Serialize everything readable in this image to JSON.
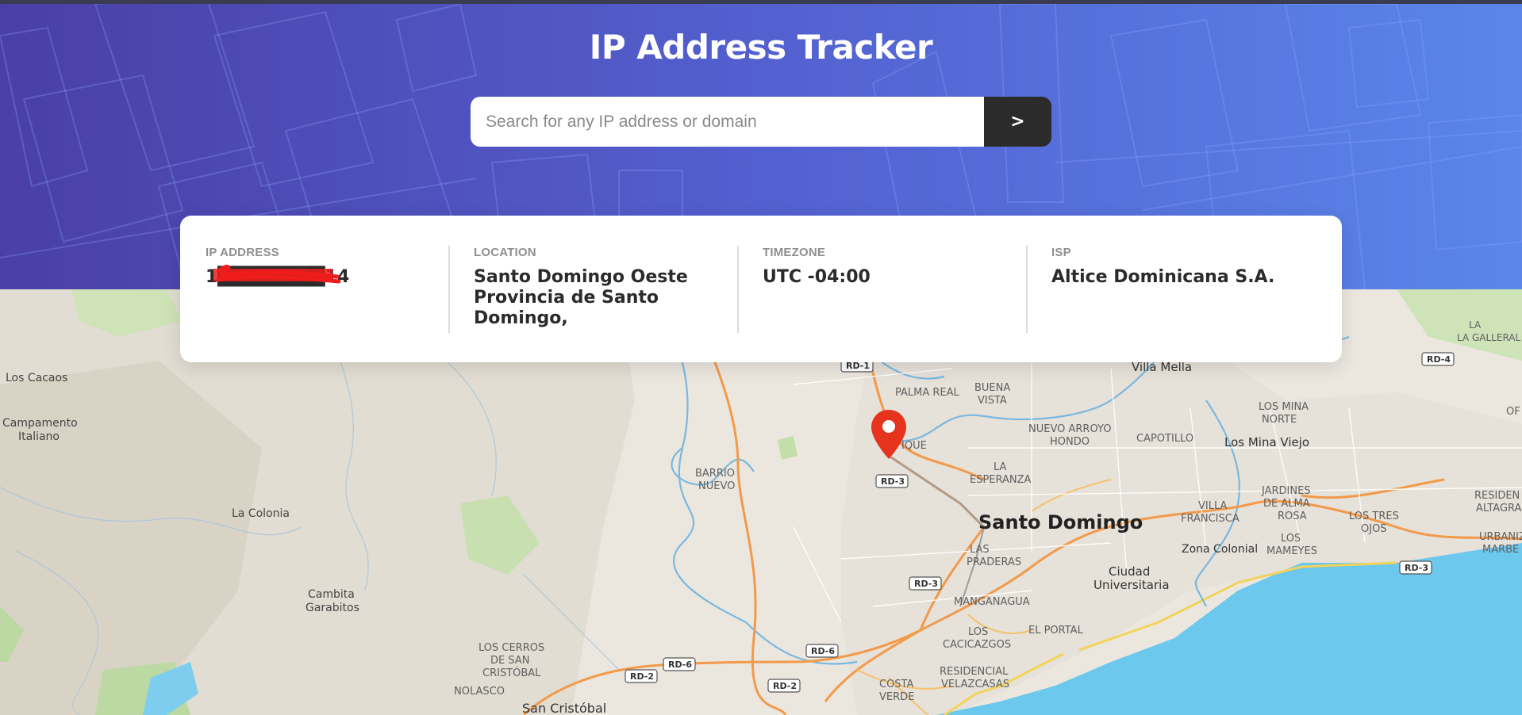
{
  "header": {
    "title": "IP Address Tracker",
    "search": {
      "placeholder": "Search for any IP address or domain",
      "value": "",
      "button_label": ">"
    }
  },
  "info": {
    "ip_label": "IP ADDRESS",
    "ip_value": "1████████14",
    "location_label": "LOCATION",
    "location_value": "Santo Domingo Oeste Provincia de Santo Domingo,",
    "timezone_label": "TIMEZONE",
    "timezone_value": "UTC -04:00",
    "isp_label": "ISP",
    "isp_value": "Altice Dominicana S.A."
  },
  "map": {
    "labels": {
      "santo_domingo": "Santo Domingo",
      "villa_mella": "Villa Mella",
      "la_galleral": "LA GALLERAL",
      "los_cacaos": "Los Cacaos",
      "campamento": "Campamento",
      "italiano": "Italiano",
      "la_colonia": "La Colonia",
      "cambita": "Cambita",
      "garabitos": "Garabitos",
      "palma_real": "PALMA REAL",
      "buena": "BUENA",
      "vista": "VISTA",
      "nuevo_arroyo": "NUEVO ARROYO",
      "hondo": "HONDO",
      "capotillo": "CAPOTILLO",
      "los_mina": "LOS MINA",
      "norte": "NORTE",
      "los_mina_viejo": "Los Mina Viejo",
      "barrio": "BARRIO",
      "nuevo": "NUEVO",
      "la_esperanza_1": "LA",
      "la_esperanza_2": "ESPERANZA",
      "ique": "IQUE",
      "jardines": "JARDINES",
      "de_alma": "DE ALMA",
      "rosa": "ROSA",
      "villa": "VILLA",
      "francisca": "FRANCISCA",
      "los_tres": "LOS TRES",
      "ojos": "OJOS",
      "resident": "RESIDEN",
      "altagra": "ALTAGRA",
      "urbaniz": "URBANIZ",
      "marbe": "MARBE",
      "los_1": "LOS",
      "mameyes": "MAMEYES",
      "zona_colonial": "Zona Colonial",
      "ciudad": "Ciudad",
      "universitaria": "Universitaria",
      "las": "LAS",
      "praderas": "PRADERAS",
      "manganagua": "MANGANAGUA",
      "el_portal": "EL PORTAL",
      "los_2": "LOS",
      "cacicazgos": "CACICAZGOS",
      "residencial": "RESIDENCIAL",
      "velazcasas": "VELAZCASAS",
      "costa": "COSTA",
      "verde": "VERDE",
      "los_cerros": "LOS CERROS",
      "de_san": "DE SAN",
      "cristobal": "CRISTÓBAL",
      "nolasco": "NOLASCO",
      "san_cristobal": "San Cristóbal",
      "of": "OF"
    },
    "shields": {
      "rd1": "RD-1",
      "rd3a": "RD-3",
      "rd3b": "RD-3",
      "rd3c": "RD-3",
      "rd4": "RD-4",
      "rd6a": "RD-6",
      "rd6b": "RD-6",
      "rd2a": "RD-2",
      "rd2b": "RD-2"
    }
  },
  "colors": {
    "header_start": "#4a3fa6",
    "header_end": "#5a86ea",
    "button": "#2b2b2b",
    "marker": "#e5331e",
    "sea": "#6cc8ec",
    "road_major": "#f29a4a",
    "river": "#7ab8e0"
  }
}
